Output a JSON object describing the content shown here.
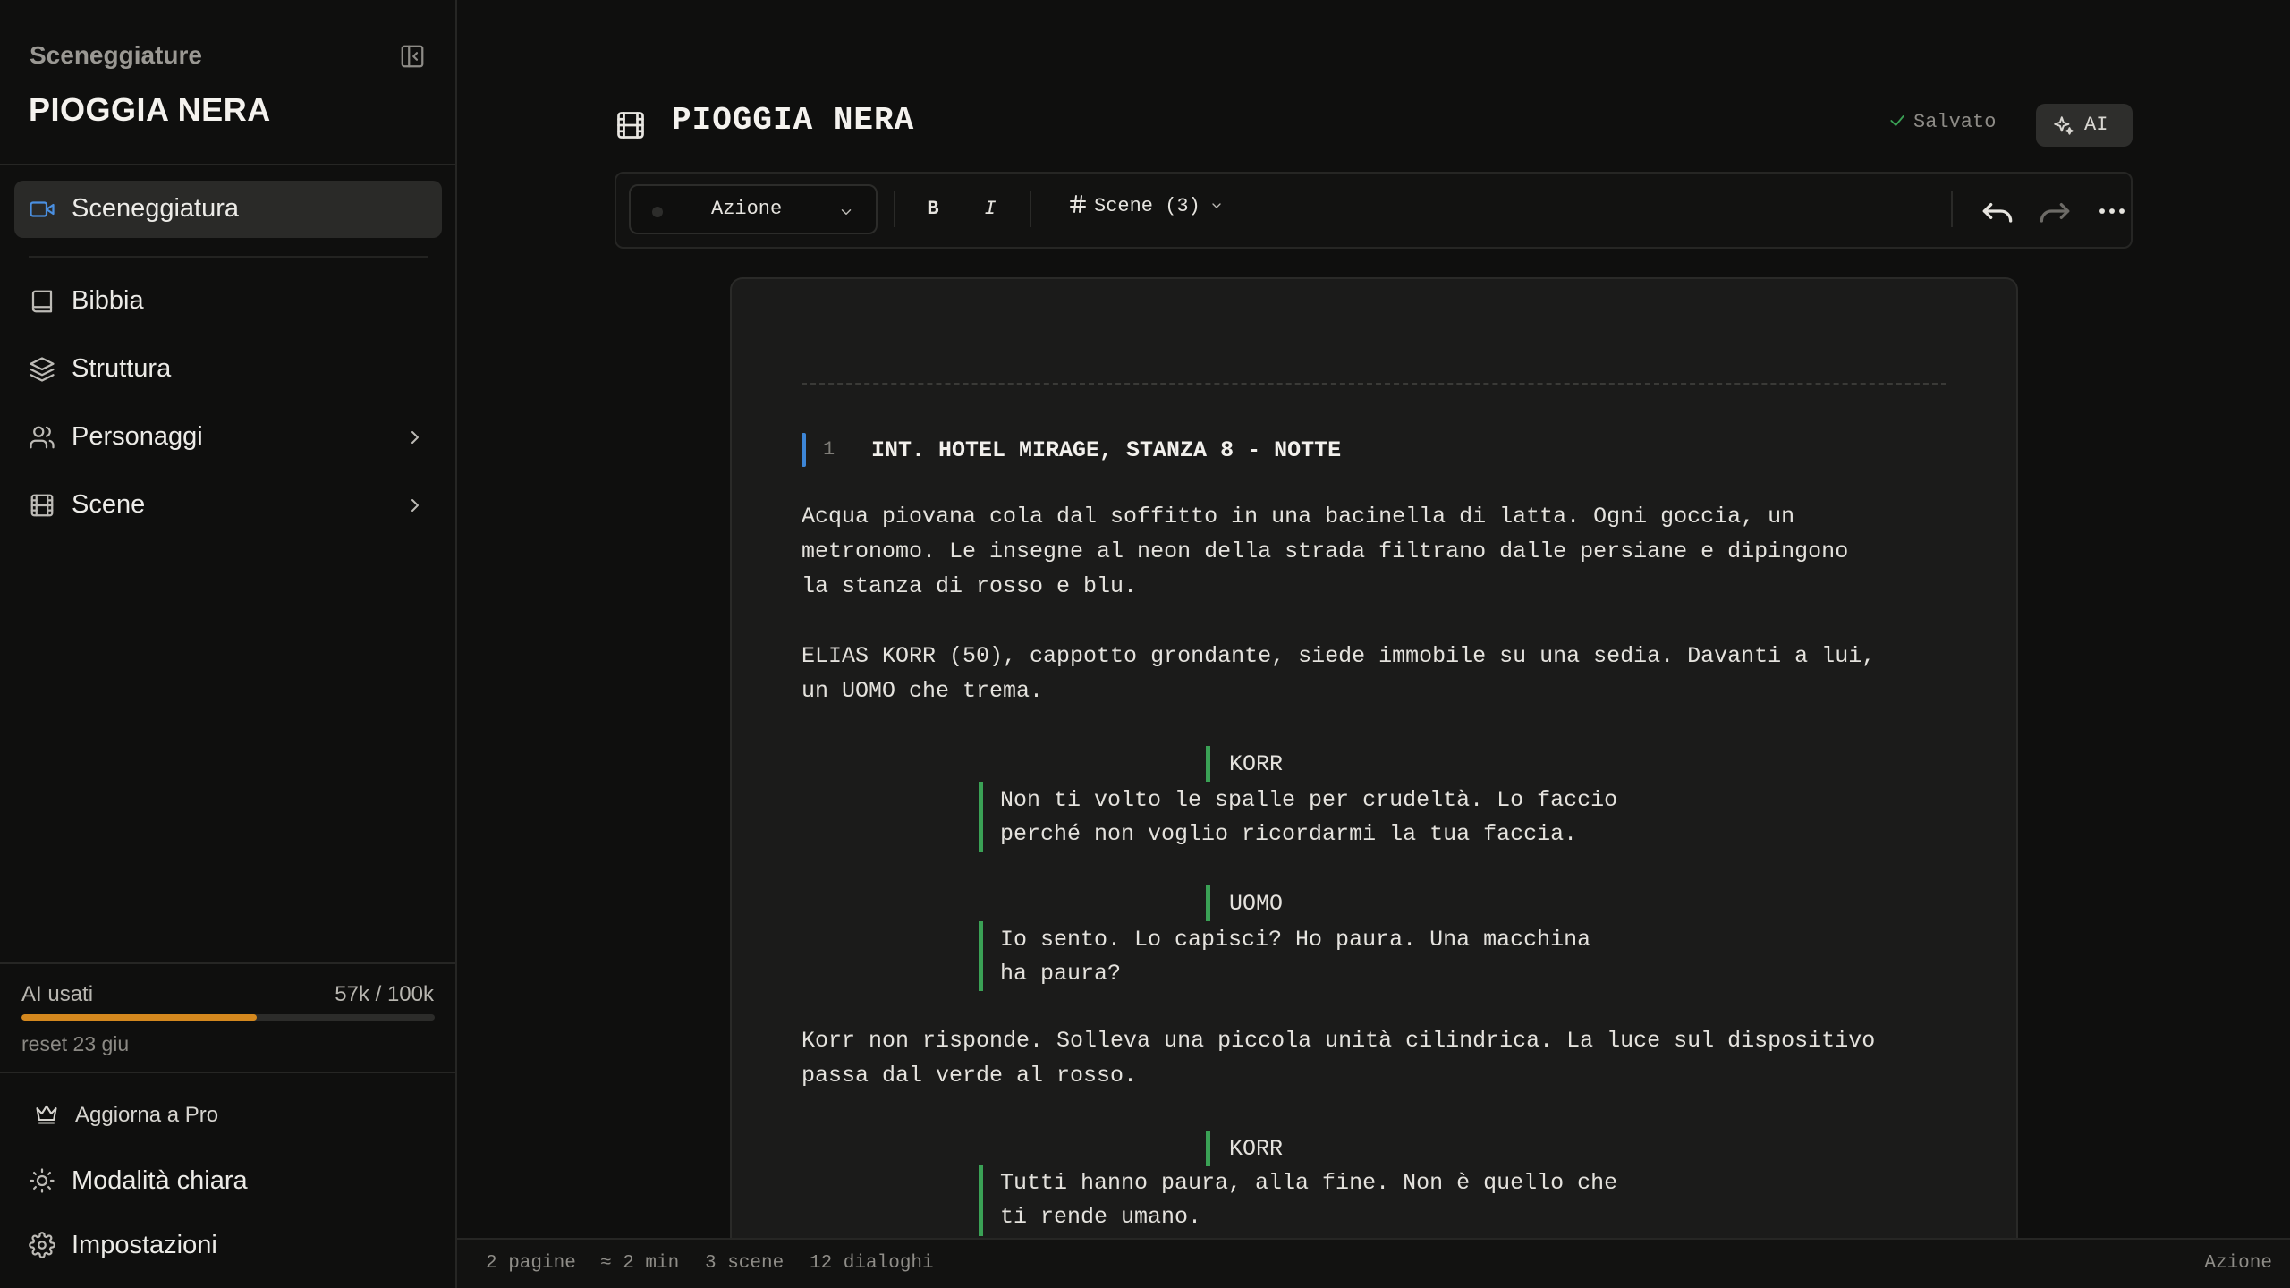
{
  "sidebar": {
    "section_label": "Sceneggiature",
    "project_title": "PIOGGIA NERA",
    "nav": [
      {
        "label": "Sceneggiatura",
        "icon": "video-camera-icon",
        "active": true
      },
      {
        "label": "Bibbia",
        "icon": "book-icon"
      },
      {
        "label": "Struttura",
        "icon": "layers-icon"
      },
      {
        "label": "Personaggi",
        "icon": "users-icon",
        "has_chevron": true
      },
      {
        "label": "Scene",
        "icon": "film-icon",
        "has_chevron": true
      }
    ],
    "usage": {
      "label": "AI usati",
      "value": "57k / 100k",
      "used_fraction": 0.57,
      "reset": "reset 23 giu"
    },
    "upgrade": "Aggiorna a Pro",
    "light_mode": "Modalità chiara",
    "settings": "Impostazioni"
  },
  "header": {
    "title": "PIOGGIA NERA",
    "saved": "Salvato",
    "ai_label": "AI"
  },
  "toolbar": {
    "element_style": "Azione",
    "bold": "B",
    "italic": "I",
    "scenes_dropdown": "Scene (3)"
  },
  "script": {
    "scene_number": "1",
    "scene_heading": "INT. HOTEL MIRAGE, STANZA 8 - NOTTE",
    "action1": [
      "Acqua piovana cola dal soffitto in una bacinella di latta. Ogni goccia, un",
      "metronomo. Le insegne al neon della strada filtrano dalle persiane e dipingono",
      "la stanza di rosso e blu."
    ],
    "action2": [
      "ELIAS KORR (50), cappotto grondante, siede immobile su una sedia. Davanti a lui,",
      "un UOMO che trema."
    ],
    "char1": "KORR",
    "dlg1": [
      "Non ti volto le spalle per crudeltà. Lo faccio",
      "perché non voglio ricordarmi la tua faccia."
    ],
    "char2": "UOMO",
    "dlg2": [
      "Io sento. Lo capisci? Ho paura. Una macchina",
      "ha paura?"
    ],
    "action3": [
      "Korr non risponde. Solleva una piccola unità cilindrica. La luce sul dispositivo",
      "passa dal verde al rosso."
    ],
    "char3": "KORR",
    "dlg3": [
      "Tutti hanno paura, alla fine. Non è quello che",
      "ti rende umano."
    ]
  },
  "status": {
    "pages": "2 pagine",
    "duration": "≈ 2 min",
    "scenes": "3 scene",
    "dialogues": "12 dialoghi",
    "current_element": "Azione"
  },
  "colors": {
    "accent_blue": "#3d86d6",
    "dialogue_green": "#3aa155",
    "usage_orange": "#d4881e"
  }
}
